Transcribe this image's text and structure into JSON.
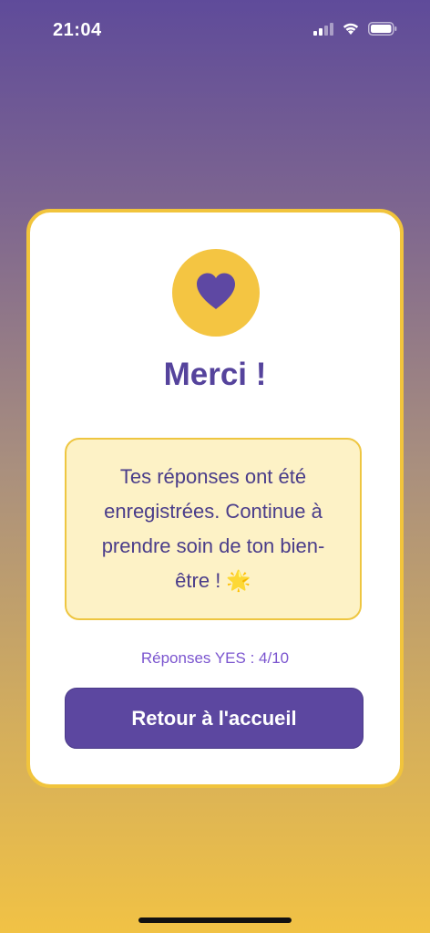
{
  "status_bar": {
    "time": "21:04",
    "icons": [
      "cellular-signal-icon",
      "wifi-icon",
      "battery-icon"
    ]
  },
  "card": {
    "icon": "heart-icon",
    "title": "Merci !",
    "message": "Tes réponses ont été enregistrées. Continue à prendre soin de ton bien-être ! 🌟",
    "stat": "Réponses YES : 4/10",
    "button_label": "Retour à l'accueil"
  },
  "colors": {
    "accent_purple": "#5c47a0",
    "accent_yellow": "#f4c542",
    "message_bg": "#fdf2c6"
  }
}
